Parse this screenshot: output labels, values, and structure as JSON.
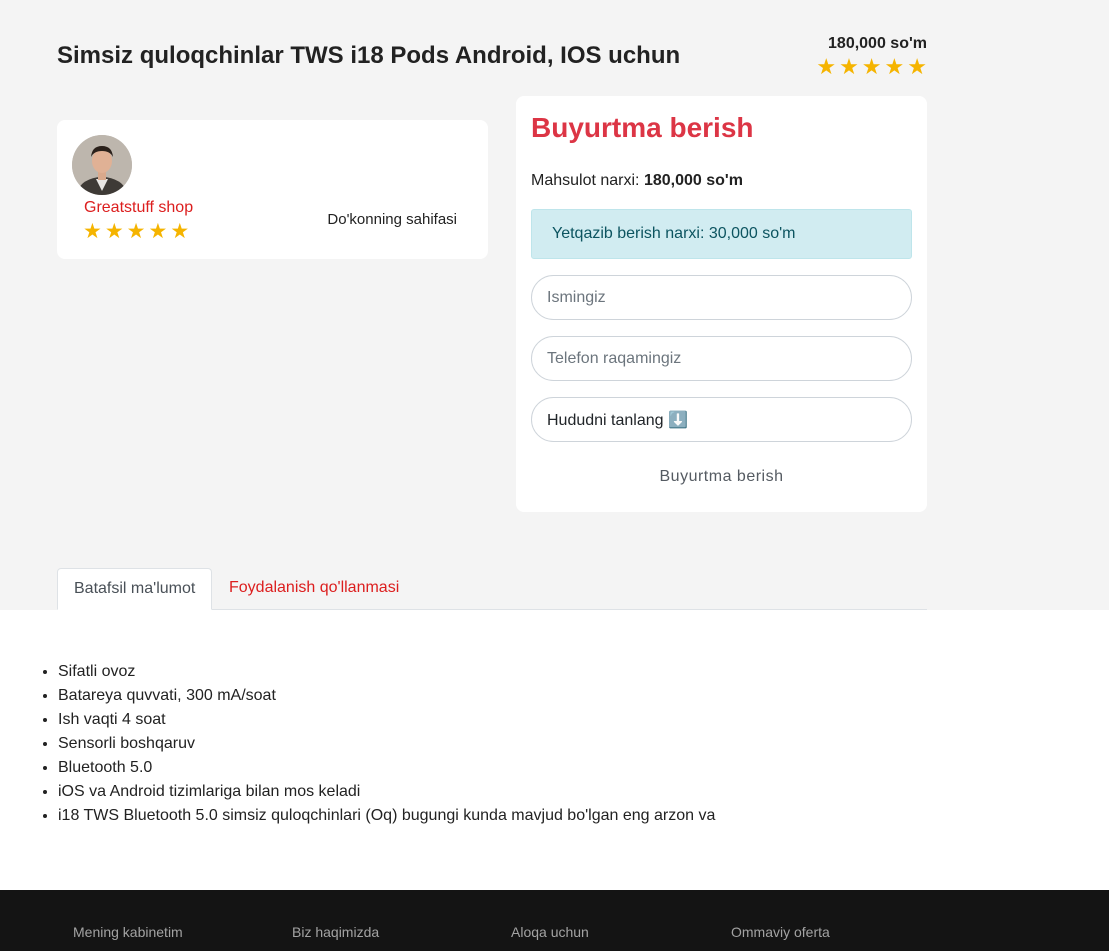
{
  "product": {
    "title": "Simsiz quloqchinlar TWS i18 Pods Android, IOS uchun",
    "price": "180,000 so'm",
    "rating_stars": 5
  },
  "seller": {
    "shop_name": "Greatstuff shop",
    "rating_stars": 5,
    "shop_page_link": "Do'konning sahifasi"
  },
  "order": {
    "title": "Buyurtma berish",
    "price_label": "Mahsulot narxi:",
    "price_value": "180,000 so'm",
    "delivery_text": "Yetqazib berish narxi: 30,000 so'm",
    "name_placeholder": "Ismingiz",
    "phone_placeholder": "Telefon raqamingiz",
    "region_select": "Hududni tanlang ⬇️",
    "submit_label": "Buyurtma berish"
  },
  "tabs": [
    {
      "label": "Batafsil ma'lumot",
      "active": true
    },
    {
      "label": "Foydalanish qo'llanmasi",
      "active": false
    }
  ],
  "features": [
    "Sifatli ovoz",
    "Batareya quvvati, 300 mA/soat",
    "Ish vaqti 4 soat",
    "Sensorli boshqaruv",
    "Bluetooth 5.0",
    "iOS va Android tizimlariga bilan mos keladi",
    "i18 TWS Bluetooth 5.0 simsiz quloqchinlari (Oq) bugungi kunda mavjud bo'lgan eng arzon va"
  ],
  "footer": {
    "links": [
      "Mening kabinetim",
      "Biz haqimizda",
      "Aloqa uchun",
      "Ommaviy oferta"
    ]
  },
  "colors": {
    "accent_red": "#dc1e1e",
    "order_title_red": "#dc3545",
    "star_yellow": "#f5b400",
    "alert_bg": "#d1ecf1",
    "footer_bg": "#141414"
  }
}
